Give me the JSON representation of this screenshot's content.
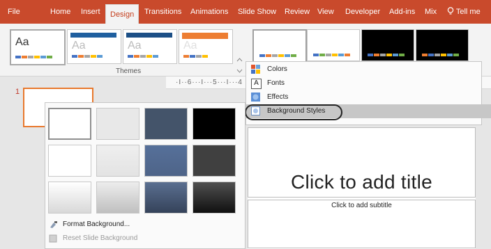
{
  "ribbon": {
    "tabs": [
      {
        "label": "File"
      },
      {
        "label": "Home"
      },
      {
        "label": "Insert"
      },
      {
        "label": "Design"
      },
      {
        "label": "Transitions"
      },
      {
        "label": "Animations"
      },
      {
        "label": "Slide Show"
      },
      {
        "label": "Review"
      },
      {
        "label": "View"
      },
      {
        "label": "Developer"
      },
      {
        "label": "Add-ins"
      },
      {
        "label": "Mix"
      },
      {
        "label": "Tell me"
      }
    ],
    "active_tab": "Design",
    "tell_me_icon": "lightbulb-icon",
    "themes_group_label": "Themes",
    "theme_thumb_text": "Aa",
    "accent_color": "#c94a2c"
  },
  "ruler": {
    "text": "·I··6···I···5···I···4"
  },
  "slides": {
    "number": "1"
  },
  "variants_menu": {
    "items": [
      {
        "label": "Colors",
        "icon": "colors-icon",
        "accesskey": "C"
      },
      {
        "label": "Fonts",
        "icon": "fonts-icon",
        "accesskey": "F"
      },
      {
        "label": "Effects",
        "icon": "effects-icon"
      },
      {
        "label": "Background Styles",
        "icon": "background-styles-icon",
        "highlighted": true
      }
    ],
    "fonts_icon_glyph": "A",
    "submenu_arrow": "›"
  },
  "background_gallery": {
    "format_background": "Format Background...",
    "reset_background": "Reset Slide Background",
    "swatch_colors": [
      [
        "#ffffff",
        "#e8e8e8",
        "#44546a",
        "#000000"
      ],
      [
        "#ffffff",
        "#e8e8e8",
        "#4e6488",
        "#404040"
      ],
      [
        "#ffffff",
        "#d9d9d9",
        "#44546a",
        "#262626"
      ]
    ]
  },
  "slide": {
    "title_placeholder": "Click to add title",
    "subtitle_placeholder": "Click to add subtitle"
  }
}
